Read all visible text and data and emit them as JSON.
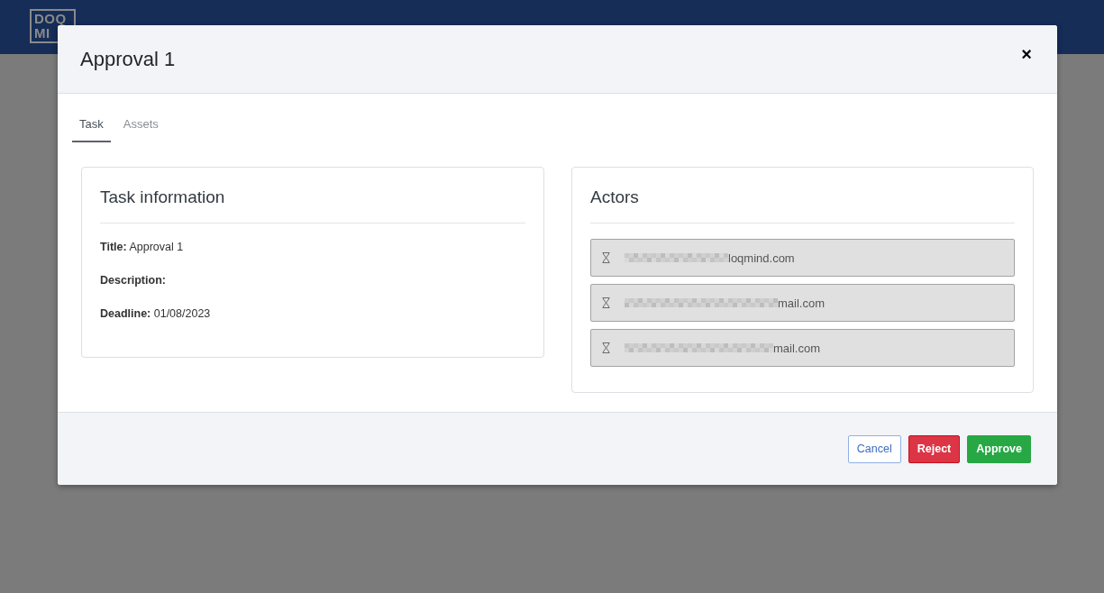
{
  "app": {
    "logo_lines": [
      "DOQ",
      "MI"
    ]
  },
  "dialog": {
    "title": "Approval 1",
    "close": "×",
    "tabs": [
      {
        "label": "Task",
        "selected": true
      },
      {
        "label": "Assets",
        "selected": false
      }
    ],
    "task_information": {
      "heading": "Task information",
      "fields": [
        {
          "label": "Title:",
          "value": "Approval 1"
        },
        {
          "label": "Description:"
        },
        {
          "label": "Deadline:",
          "value": "01/08/2023"
        }
      ]
    },
    "actors": {
      "heading": "Actors",
      "items": [
        {
          "redacted": true,
          "email": "loqmind.com"
        },
        {
          "redacted": true,
          "email": "mail.com"
        },
        {
          "redacted": true,
          "email": "mail.com"
        }
      ]
    },
    "buttons": [
      {
        "label": "Cancel",
        "kind": "secondary"
      },
      {
        "label": "Reject",
        "kind": "danger"
      },
      {
        "label": "Approve",
        "kind": "success"
      }
    ]
  }
}
